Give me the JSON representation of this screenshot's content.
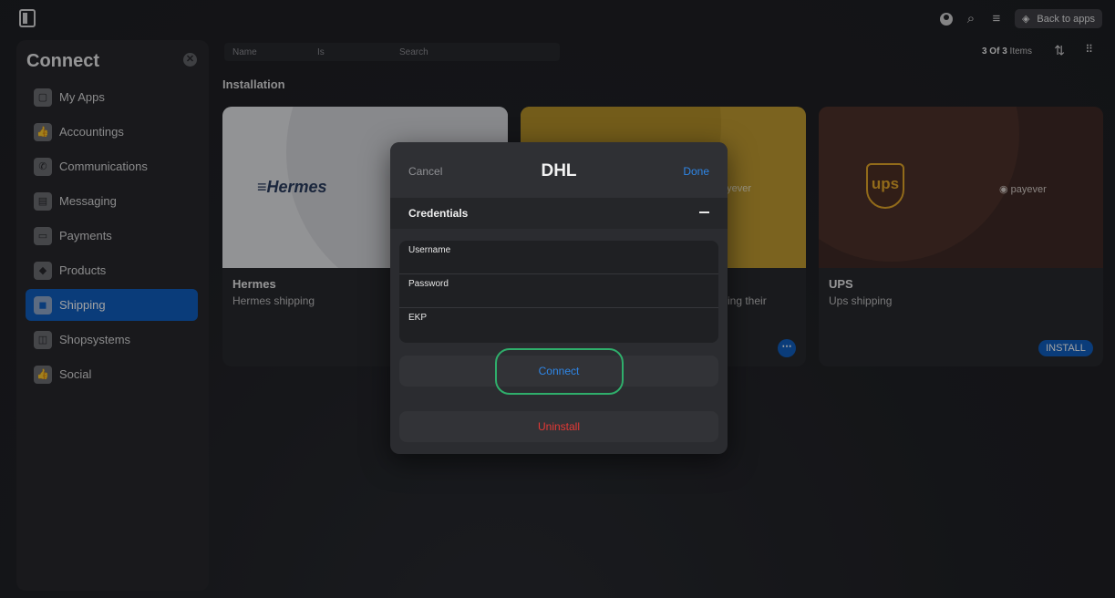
{
  "topbar": {
    "icons": [
      "sidebar-toggle-icon",
      "user-icon",
      "search-icon",
      "menu-icon",
      "layers-icon"
    ],
    "back_label": "Back to apps"
  },
  "sidebar": {
    "title": "Connect",
    "close_glyph": "✕",
    "items": [
      {
        "label": "My Apps",
        "icon": "apps-icon",
        "glyph": "▢"
      },
      {
        "label": "Accountings",
        "icon": "thumbs-up-icon",
        "glyph": "👍"
      },
      {
        "label": "Communications",
        "icon": "phone-icon",
        "glyph": "✆"
      },
      {
        "label": "Messaging",
        "icon": "chat-icon",
        "glyph": "▤"
      },
      {
        "label": "Payments",
        "icon": "card-icon",
        "glyph": "▭"
      },
      {
        "label": "Products",
        "icon": "tag-icon",
        "glyph": "◆"
      },
      {
        "label": "Shipping",
        "icon": "box-icon",
        "glyph": "◼",
        "active": true
      },
      {
        "label": "Shopsystems",
        "icon": "bag-icon",
        "glyph": "◫"
      },
      {
        "label": "Social",
        "icon": "thumbs-up-icon",
        "glyph": "👍"
      }
    ]
  },
  "filter": {
    "name": "Name",
    "is": "Is",
    "search": "Search",
    "count_bold": "3 Of 3",
    "count_suffix": "Items"
  },
  "section_title": "Installation",
  "cards": {
    "hermes": {
      "logo": "≡Hermes",
      "title": "Hermes",
      "subtitle": "Hermes shipping"
    },
    "dhl": {
      "payever": "ayever",
      "subtitle_fragment": "ring their",
      "more": "⋯"
    },
    "ups": {
      "logo": "ups",
      "payever": "◉ payever",
      "title": "UPS",
      "subtitle": "Ups shipping",
      "install_label": "INSTALL"
    }
  },
  "modal": {
    "cancel_label": "Cancel",
    "title": "DHL",
    "done_label": "Done",
    "section_label": "Credentials",
    "fields": [
      {
        "label": "Username",
        "value": ""
      },
      {
        "label": "Password",
        "value": ""
      },
      {
        "label": "EKP",
        "value": ""
      }
    ],
    "connect_label": "Connect",
    "uninstall_label": "Uninstall"
  },
  "colors": {
    "accent": "#0a5bbd",
    "link": "#2f86e6",
    "danger": "#e53935",
    "highlight": "#2fae6b"
  }
}
